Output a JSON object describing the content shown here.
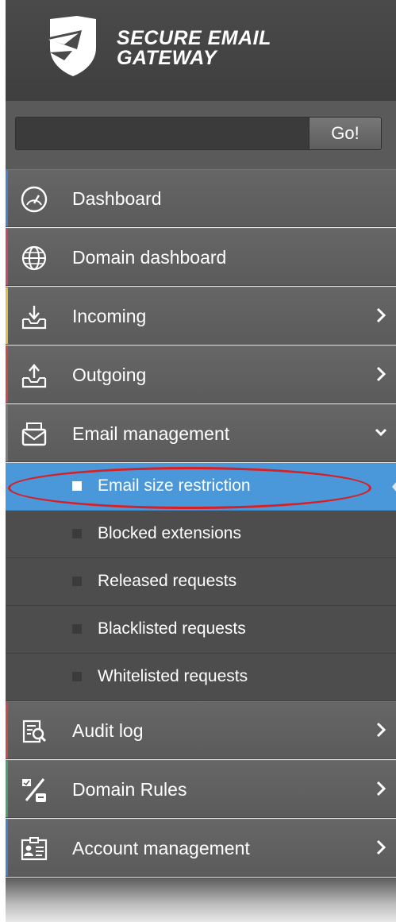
{
  "brand": {
    "line1": "SECURE EMAIL",
    "line2": "GATEWAY"
  },
  "search": {
    "value": "",
    "go_label": "Go!"
  },
  "menu": [
    {
      "label": "Dashboard",
      "icon": "dashboard-gauge-icon",
      "accent": "#4a80c8",
      "has_chevron": false
    },
    {
      "label": "Domain dashboard",
      "icon": "globe-icon",
      "accent": "#c8486a",
      "has_chevron": false
    },
    {
      "label": "Incoming",
      "icon": "inbox-download-icon",
      "accent": "#d8c04a",
      "has_chevron": true
    },
    {
      "label": "Outgoing",
      "icon": "outbox-upload-icon",
      "accent": "#c84a4a",
      "has_chevron": true
    },
    {
      "label": "Email management",
      "icon": "envelope-stack-icon",
      "accent": "#7a7a7a",
      "expanded": true
    }
  ],
  "submenu": [
    {
      "label": "Email size restriction",
      "active": true
    },
    {
      "label": "Blocked extensions",
      "active": false
    },
    {
      "label": "Released requests",
      "active": false
    },
    {
      "label": "Blacklisted requests",
      "active": false
    },
    {
      "label": "Whitelisted requests",
      "active": false
    }
  ],
  "menu_bottom": [
    {
      "label": "Audit log",
      "icon": "audit-log-icon",
      "accent": "#c84a4a",
      "has_chevron": true
    },
    {
      "label": "Domain Rules",
      "icon": "percent-rules-icon",
      "accent": "#4aa06a",
      "has_chevron": true
    },
    {
      "label": "Account management",
      "icon": "account-card-icon",
      "accent": "#4a80c8",
      "has_chevron": true
    }
  ],
  "colors": {
    "active": "#4a97d9",
    "highlight_ring": "#d81f24"
  }
}
